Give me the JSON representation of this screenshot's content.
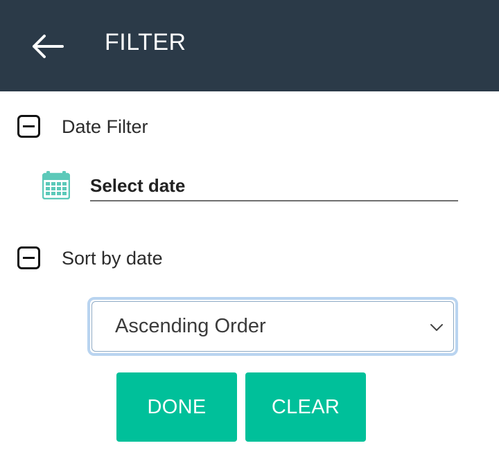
{
  "header": {
    "title": "FILTER",
    "back_icon": "arrow-left-icon",
    "background_color": "#2b3a48"
  },
  "date_filter": {
    "label": "Date Filter",
    "toggle_icon": "collapse-minus-icon",
    "calendar_icon": "calendar-icon",
    "calendar_color": "#5cc9b9",
    "input_placeholder": "Select date",
    "input_value": ""
  },
  "sort_filter": {
    "label": "Sort by date",
    "toggle_icon": "collapse-minus-icon",
    "selected_option": "Ascending Order",
    "dropdown_icon": "chevron-down-icon"
  },
  "actions": {
    "done_label": "DONE",
    "clear_label": "CLEAR",
    "button_color": "#00c09a"
  }
}
